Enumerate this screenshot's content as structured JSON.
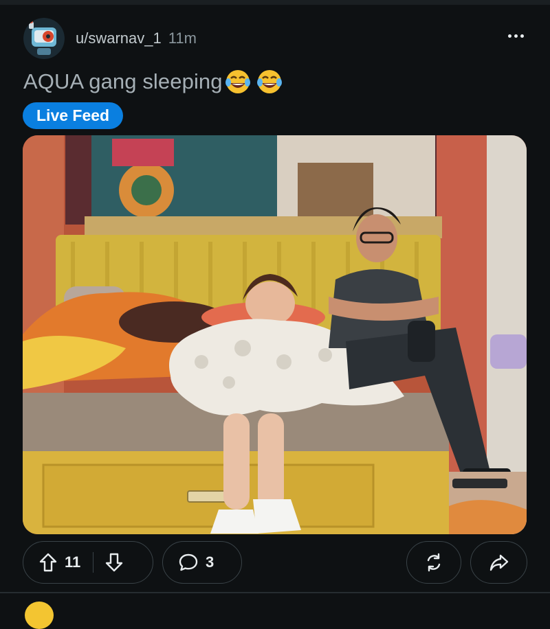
{
  "post": {
    "username": "u/swarnav_1",
    "time": "11m",
    "title": "AQUA gang sleeping",
    "title_emojis": [
      "face-with-tears-of-joy-icon",
      "face-with-tears-of-joy-icon"
    ],
    "flair": "Live Feed",
    "flair_color": "#0a7fe0"
  },
  "actions": {
    "upvotes": "11",
    "comments": "3"
  },
  "icons": {
    "more": "more-horizontal-icon",
    "upvote": "arrow-up-icon",
    "downvote": "arrow-down-icon",
    "comment": "comment-bubble-icon",
    "award": "refresh-award-icon",
    "share": "share-arrow-icon"
  },
  "colors": {
    "background": "#0e1113",
    "accent": "#0a7fe0"
  }
}
